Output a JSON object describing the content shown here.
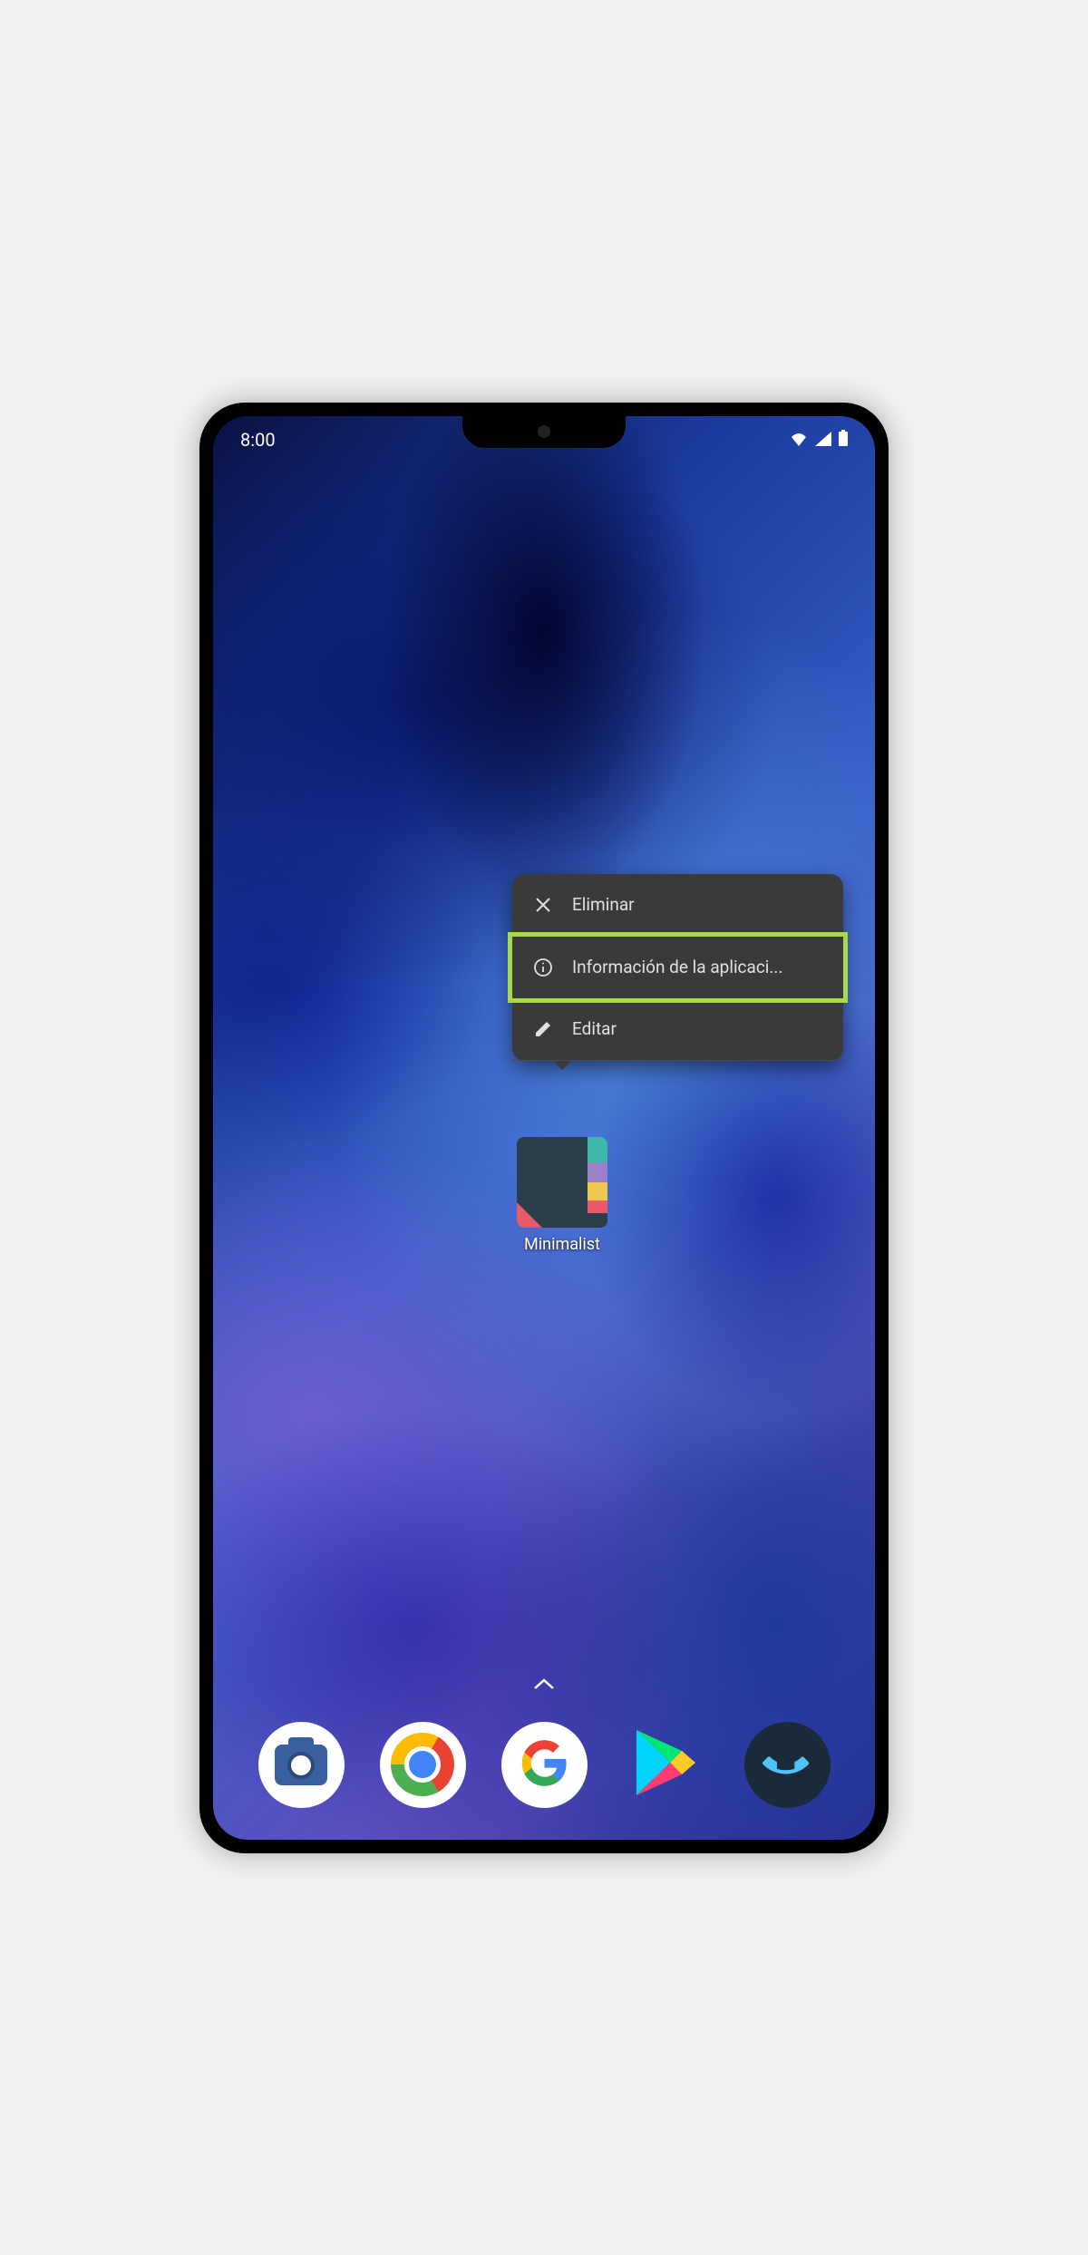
{
  "status_bar": {
    "time": "8:00"
  },
  "context_menu": {
    "items": [
      {
        "icon": "close-icon",
        "label": "Eliminar"
      },
      {
        "icon": "info-icon",
        "label": "Información de la aplicaci...",
        "highlighted": true
      },
      {
        "icon": "edit-icon",
        "label": "Editar"
      }
    ]
  },
  "selected_app": {
    "name": "Minimalist"
  },
  "dock": {
    "apps": [
      {
        "name": "camera"
      },
      {
        "name": "chrome"
      },
      {
        "name": "google"
      },
      {
        "name": "play-store"
      },
      {
        "name": "phone"
      }
    ]
  },
  "colors": {
    "highlight_border": "#a8d948",
    "menu_bg": "#3a3a3a",
    "menu_text": "#e0e0e0"
  }
}
